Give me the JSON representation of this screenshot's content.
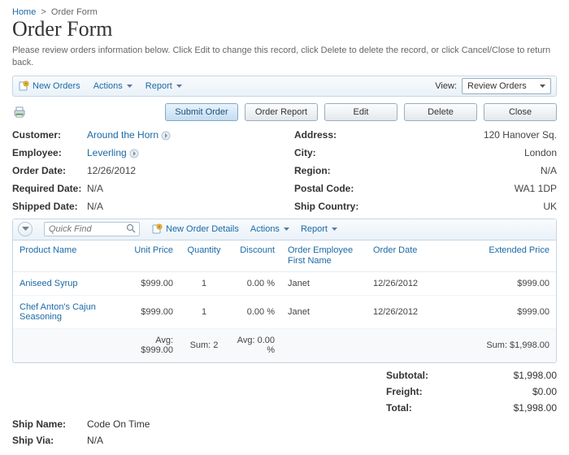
{
  "breadcrumb": {
    "home": "Home",
    "current": "Order Form"
  },
  "page_title": "Order Form",
  "subtitle": "Please review orders information below. Click Edit to change this record, click Delete to delete the record, or click Cancel/Close to return back.",
  "toolbar": {
    "new_orders": "New Orders",
    "actions": "Actions",
    "report": "Report",
    "view_label": "View:",
    "view_value": "Review Orders"
  },
  "buttons": {
    "submit": "Submit Order",
    "order_report": "Order Report",
    "edit": "Edit",
    "delete": "Delete",
    "close": "Close"
  },
  "fields_left": {
    "customer_label": "Customer:",
    "customer_value": "Around the Horn",
    "employee_label": "Employee:",
    "employee_value": "Leverling",
    "order_date_label": "Order Date:",
    "order_date_value": "12/26/2012",
    "required_date_label": "Required Date:",
    "required_date_value": "N/A",
    "shipped_date_label": "Shipped Date:",
    "shipped_date_value": "N/A"
  },
  "fields_right": {
    "address_label": "Address:",
    "address_value": "120 Hanover Sq.",
    "city_label": "City:",
    "city_value": "London",
    "region_label": "Region:",
    "region_value": "N/A",
    "postal_label": "Postal Code:",
    "postal_value": "WA1 1DP",
    "country_label": "Ship Country:",
    "country_value": "UK"
  },
  "details_toolbar": {
    "quick_find_placeholder": "Quick Find",
    "new_details": "New Order Details",
    "actions": "Actions",
    "report": "Report"
  },
  "grid": {
    "headers": {
      "product": "Product Name",
      "unit_price": "Unit Price",
      "quantity": "Quantity",
      "discount": "Discount",
      "emp_first": "Order Employee First Name",
      "order_date": "Order Date",
      "ext_price": "Extended Price"
    },
    "rows": [
      {
        "product": "Aniseed Syrup",
        "unit_price": "$999.00",
        "quantity": "1",
        "discount": "0.00 %",
        "emp_first": "Janet",
        "order_date": "12/26/2012",
        "ext_price": "$999.00"
      },
      {
        "product": "Chef Anton's Cajun Seasoning",
        "unit_price": "$999.00",
        "quantity": "1",
        "discount": "0.00 %",
        "emp_first": "Janet",
        "order_date": "12/26/2012",
        "ext_price": "$999.00"
      }
    ],
    "footer": {
      "avg_price": "Avg: $999.00",
      "sum_qty": "Sum: 2",
      "avg_disc": "Avg: 0.00 %",
      "sum_ext": "Sum: $1,998.00"
    }
  },
  "totals": {
    "subtotal_label": "Subtotal:",
    "subtotal_value": "$1,998.00",
    "freight_label": "Freight:",
    "freight_value": "$0.00",
    "total_label": "Total:",
    "total_value": "$1,998.00"
  },
  "ship": {
    "name_label": "Ship Name:",
    "name_value": "Code On Time",
    "via_label": "Ship Via:",
    "via_value": "N/A"
  }
}
